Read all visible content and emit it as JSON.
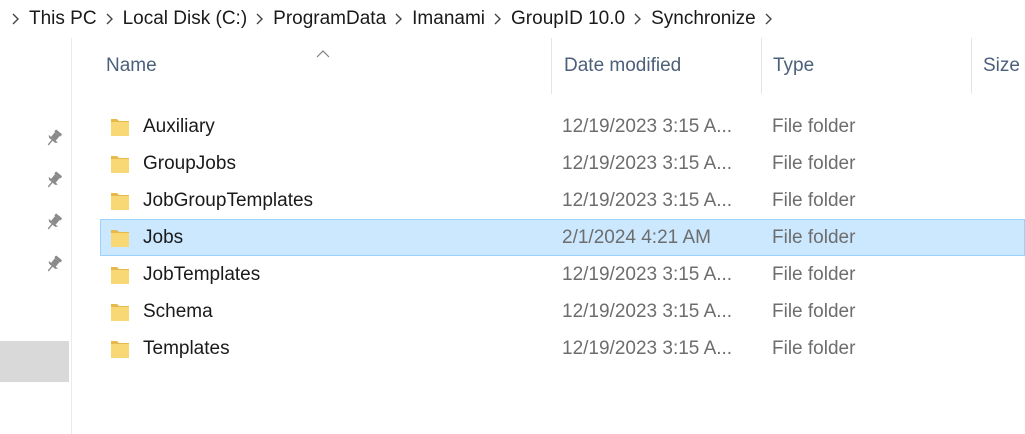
{
  "breadcrumb": {
    "items": [
      "This PC",
      "Local Disk (C:)",
      "ProgramData",
      "Imanami",
      "GroupID 10.0",
      "Synchronize"
    ]
  },
  "columns": {
    "name": "Name",
    "date_modified": "Date modified",
    "type": "Type",
    "size": "Size"
  },
  "sort": {
    "column": "name",
    "direction": "ascending"
  },
  "files": [
    {
      "name": "Auxiliary",
      "date": "12/19/2023 3:15 A...",
      "type": "File folder",
      "icon": "folder-icon",
      "selected": false
    },
    {
      "name": "GroupJobs",
      "date": "12/19/2023 3:15 A...",
      "type": "File folder",
      "icon": "folder-icon",
      "selected": false
    },
    {
      "name": "JobGroupTemplates",
      "date": "12/19/2023 3:15 A...",
      "type": "File folder",
      "icon": "folder-icon",
      "selected": false
    },
    {
      "name": "Jobs",
      "date": "2/1/2024 4:21 AM",
      "type": "File folder",
      "icon": "folder-icon",
      "selected": true
    },
    {
      "name": "JobTemplates",
      "date": "12/19/2023 3:15 A...",
      "type": "File folder",
      "icon": "folder-icon",
      "selected": false
    },
    {
      "name": "Schema",
      "date": "12/19/2023 3:15 A...",
      "type": "File folder",
      "icon": "folder-icon",
      "selected": false
    },
    {
      "name": "Templates",
      "date": "12/19/2023 3:15 A...",
      "type": "File folder",
      "icon": "folder-icon",
      "selected": false
    }
  ],
  "nav_pane": {
    "pinned_icons": [
      "pin-icon",
      "pin-icon",
      "pin-icon",
      "pin-icon"
    ]
  },
  "colors": {
    "selection_bg": "#cce8ff",
    "selection_border": "#99d1ff",
    "folder_yellow": "#f8d775",
    "header_text": "#4c607a"
  }
}
